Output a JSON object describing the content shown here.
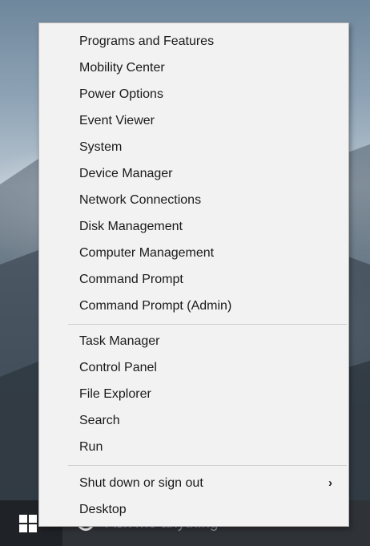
{
  "menu": {
    "group1": [
      "Programs and Features",
      "Mobility Center",
      "Power Options",
      "Event Viewer",
      "System",
      "Device Manager",
      "Network Connections",
      "Disk Management",
      "Computer Management",
      "Command Prompt",
      "Command Prompt (Admin)"
    ],
    "group2": [
      "Task Manager",
      "Control Panel",
      "File Explorer",
      "Search",
      "Run"
    ],
    "group3": [
      "Shut down or sign out",
      "Desktop"
    ],
    "submenu_indicator": "›"
  },
  "taskbar": {
    "search_placeholder": "Ask me anything",
    "start_icon": "windows-logo-icon",
    "search_icon": "cortana-ring-icon"
  },
  "colors": {
    "menu_background": "#f2f2f2",
    "menu_text": "#1a1a1a",
    "taskbar": "#1f2226"
  }
}
